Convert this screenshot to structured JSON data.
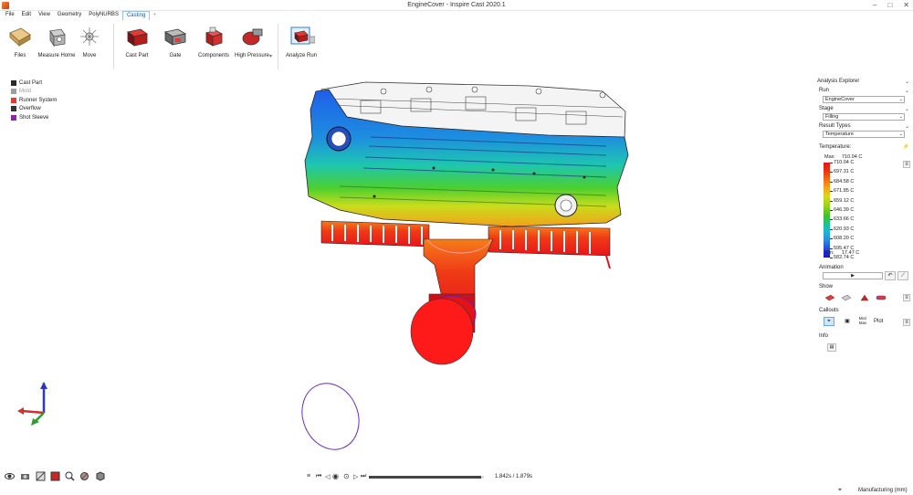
{
  "window": {
    "title": "EngineCover - Inspire Cast 2020.1",
    "controls": [
      "–",
      "□",
      "✕"
    ]
  },
  "menu": {
    "items": [
      "File",
      "Edit",
      "View",
      "Geometry",
      "PolyNURBS",
      "Casting"
    ],
    "active": "Casting",
    "plus": "+"
  },
  "ribbon": {
    "files": "Files",
    "measure": "Measure Home",
    "move": "Move",
    "cast_part": "Cast Part",
    "gate": "Gate",
    "components": "Components",
    "high_pressure": "High Pressure",
    "analyze": "Analyze Run"
  },
  "legend": [
    {
      "label": "Cast Part",
      "color": "#2a2a2a"
    },
    {
      "label": "Mold",
      "color": "#9e9e9e"
    },
    {
      "label": "Runner System",
      "color": "#e53935"
    },
    {
      "label": "Overflow",
      "color": "#333333"
    },
    {
      "label": "Shot Sleeve",
      "color": "#8e24aa"
    }
  ],
  "explorer": {
    "title": "Analysis Explorer",
    "run_label": "Run",
    "run_value": "EngineCover",
    "stage_label": "Stage",
    "stage_value": "Filling",
    "result_label": "Result Types",
    "result_value": "Temperature",
    "temp_label": "Temperature:",
    "max_label": "Max:",
    "min_label": "Min:",
    "max_value": "710.04 C",
    "min_value": "17.47 C",
    "scale_values": [
      "710.04 C",
      "697.31 C",
      "684.58 C",
      "671.85 C",
      "659.12 C",
      "646.39 C",
      "633.66 C",
      "620.93 C",
      "608.20 C",
      "595.47 C",
      "582.74 C"
    ],
    "animation_label": "Animation",
    "play": "▶",
    "show_label": "Show",
    "callouts_label": "Callouts",
    "minmax": "Min/ Max",
    "plot": "Plot",
    "info_label": "Info"
  },
  "bottom": {
    "time": "1.842s / 1.879s",
    "progress": 0.98,
    "units": "Manufacturing (mm)"
  },
  "colors": {
    "accent": "#0b5aa6",
    "hot": "#e8141a",
    "cold": "#1a10c8"
  }
}
